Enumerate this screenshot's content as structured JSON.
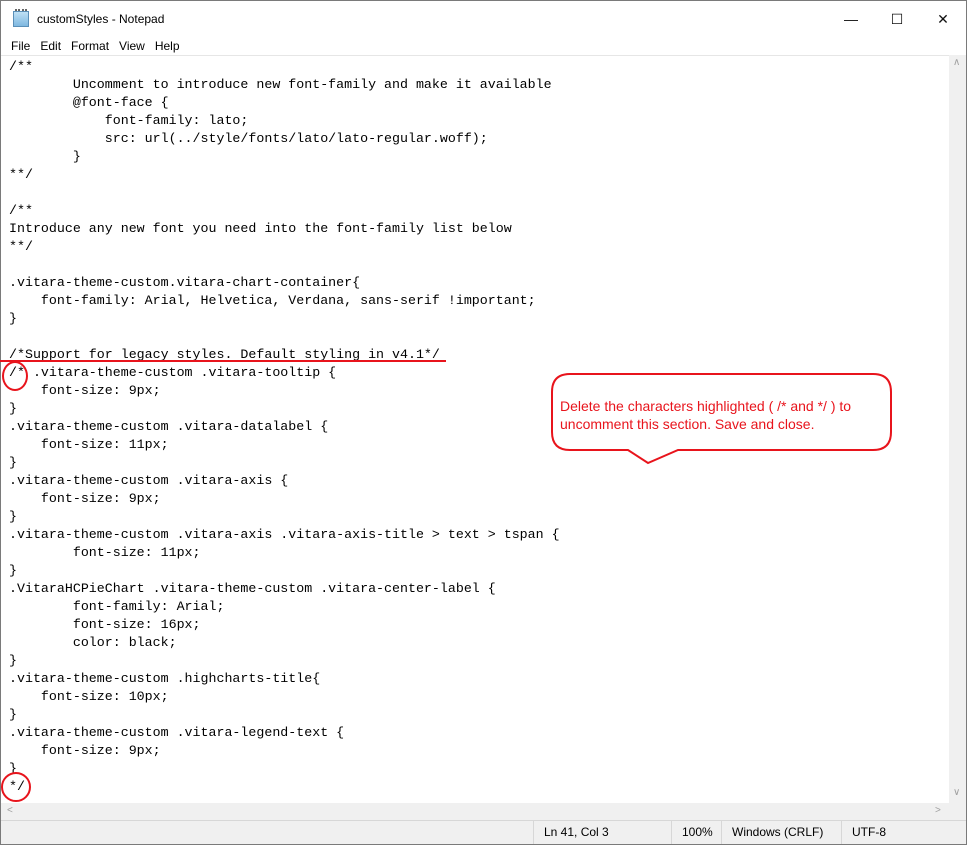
{
  "window": {
    "title": "customStyles - Notepad",
    "controls": [
      "minimize",
      "maximize",
      "close"
    ]
  },
  "menu": [
    "File",
    "Edit",
    "Format",
    "View",
    "Help"
  ],
  "editor": {
    "text": "/**\n        Uncomment to introduce new font-family and make it available\n        @font-face {\n            font-family: lato;\n            src: url(../style/fonts/lato/lato-regular.woff);\n        }\n**/\n\n/**\nIntroduce any new font you need into the font-family list below\n**/\n\n.vitara-theme-custom.vitara-chart-container{\n    font-family: Arial, Helvetica, Verdana, sans-serif !important;\n}\n\n/*Support for legacy styles. Default styling in v4.1*/\n/* .vitara-theme-custom .vitara-tooltip {\n    font-size: 9px;\n}\n.vitara-theme-custom .vitara-datalabel {\n    font-size: 11px;\n}\n.vitara-theme-custom .vitara-axis {\n    font-size: 9px;\n}\n.vitara-theme-custom .vitara-axis .vitara-axis-title > text > tspan {\n        font-size: 11px;\n}\n.VitaraHCPieChart .vitara-theme-custom .vitara-center-label {\n        font-family: Arial;\n        font-size: 16px;\n        color: black;\n}\n.vitara-theme-custom .highcharts-title{\n    font-size: 10px;\n}\n.vitara-theme-custom .vitara-legend-text {\n    font-size: 9px;\n}\n*/"
  },
  "annotation": {
    "text": "Delete the characters highlighted ( /* and */ ) to uncomment this section. Save and close.",
    "color": "#e8141c"
  },
  "status": {
    "position": "Ln 41, Col 3",
    "zoom": "100%",
    "line_ending": "Windows (CRLF)",
    "encoding": "UTF-8"
  }
}
